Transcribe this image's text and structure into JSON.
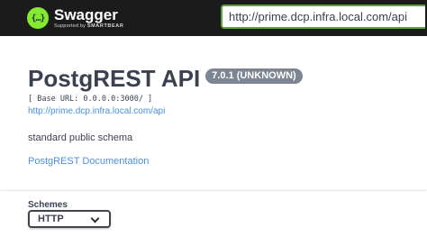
{
  "topbar": {
    "logo_glyph": "{…}",
    "logo_name": "Swagger",
    "logo_sub_prefix": "Supported by",
    "logo_sub_brand": "SMARTBEAR",
    "url_value": "http://prime.dcp.infra.local.com/api",
    "colors": {
      "background": "#1b1b1b",
      "logo": "#85ea2d",
      "input_border": "#62a03f"
    }
  },
  "info": {
    "title": "PostgREST API",
    "version": "7.0.1 (UNKNOWN)",
    "base_url": "[ Base URL: 0.0.0.0:3000/ ]",
    "spec_url": "http://prime.dcp.infra.local.com/api",
    "description": "standard public schema",
    "doc_link": "PostgREST Documentation",
    "colors": {
      "text": "#3b4151",
      "link": "#4990e2",
      "version_badge": "#7d8492"
    }
  },
  "schemes": {
    "label": "Schemes",
    "selected": "HTTP",
    "icon": "chevron-down-icon"
  }
}
